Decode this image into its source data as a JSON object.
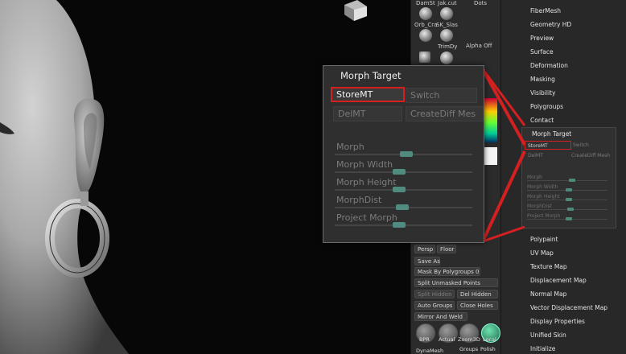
{
  "tool_strip": {
    "top_labels": [
      "DamSt",
      "Jak.cut",
      "Dots"
    ],
    "brush_labels": [
      "Orb_Cra",
      "SK_Slas"
    ],
    "trimdy": "TrimDy",
    "alpha_off": "Alpha Off",
    "persp": "Persp",
    "floor": "Floor",
    "save_as": "Save As",
    "mask_by_polygroups": "Mask By Polygroups",
    "mask_value": "0",
    "split_unmasked": "Split Unmasked Points",
    "split_hidden": "Split Hidden",
    "del_hidden": "Del Hidden",
    "auto_groups": "Auto Groups",
    "close_holes": "Close Holes",
    "mirror_and_weld": "Mirror And Weld",
    "bpr": "BPR",
    "actual": "Actual",
    "zoom2d": "Zoom3D",
    "local": "Local",
    "dynamesh": "DynaMesh",
    "groups": "Groups",
    "polish": "Polish"
  },
  "right_menu": {
    "top_items": [
      "FiberMesh",
      "Geometry HD",
      "Preview",
      "Surface",
      "Deformation",
      "Masking",
      "Visibility",
      "Polygroups",
      "Contact"
    ],
    "bottom_items": [
      "Polypaint",
      "UV Map",
      "Texture Map",
      "Displacement Map",
      "Normal Map",
      "Vector Displacement Map",
      "Display Properties",
      "Unified Skin",
      "Initialize"
    ]
  },
  "mini_panel": {
    "title": "Morph Target",
    "store": "StoreMT",
    "switch": "Switch",
    "del": "DelMT",
    "create_diff": "CreateDiff Mesh",
    "sliders": [
      "Morph",
      "Morph Width",
      "Morph Height",
      "MorphDist",
      "Project Morph"
    ]
  },
  "morph_target_panel": {
    "title": "Morph Target",
    "store_mt": "StoreMT",
    "switch": "Switch",
    "del_mt": "DelMT",
    "create_diff_mesh": "CreateDiff Mes",
    "sliders": [
      {
        "label": "Morph",
        "fraction": 0.52
      },
      {
        "label": "Morph Width",
        "fraction": 0.47
      },
      {
        "label": "Morph Height",
        "fraction": 0.47
      },
      {
        "label": "MorphDist",
        "fraction": 0.49
      },
      {
        "label": "Project Morph",
        "fraction": 0.47
      }
    ]
  },
  "colors": {
    "highlight": "#d42020",
    "slider_knob": "#4f8b7e",
    "panel_bg": "#2f2f2f"
  }
}
